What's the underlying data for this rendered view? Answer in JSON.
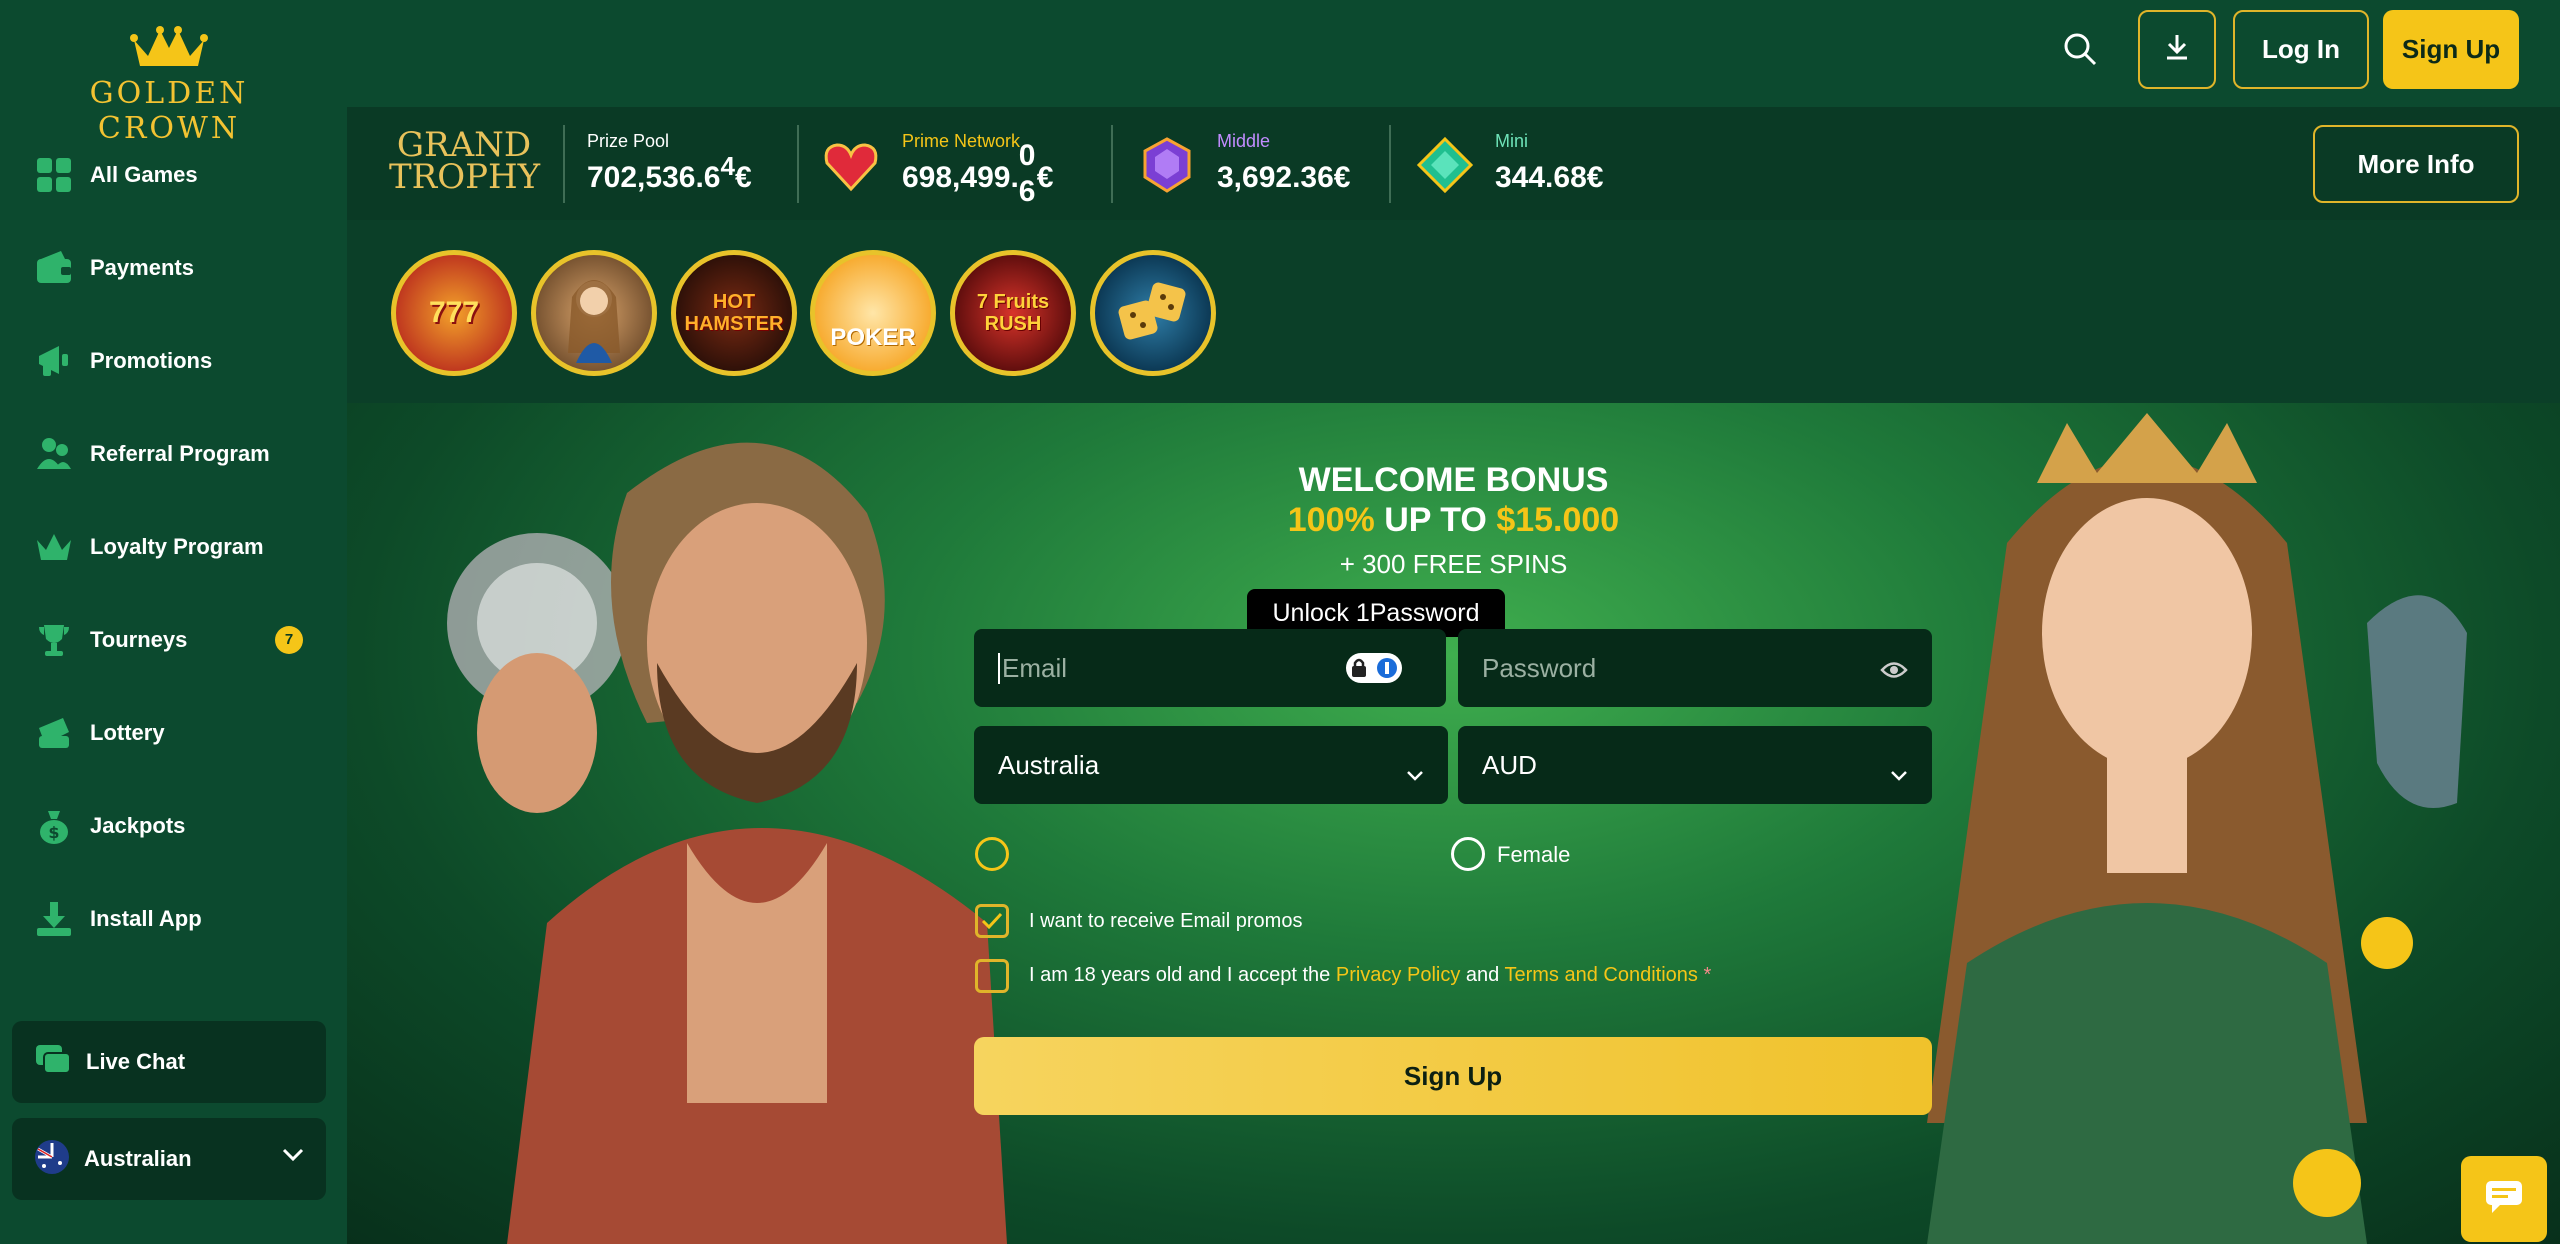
{
  "brand": {
    "name": "GOLDEN CROWN",
    "accent": "#f5c518"
  },
  "sidebar": {
    "items": [
      {
        "label": "All Games",
        "icon": "grid-icon"
      },
      {
        "label": "Payments",
        "icon": "wallet-icon"
      },
      {
        "label": "Promotions",
        "icon": "megaphone-icon"
      },
      {
        "label": "Referral Program",
        "icon": "users-icon"
      },
      {
        "label": "Loyalty Program",
        "icon": "crown-icon"
      },
      {
        "label": "Tourneys",
        "icon": "trophy-icon",
        "badge": "7"
      },
      {
        "label": "Lottery",
        "icon": "ticket-icon"
      },
      {
        "label": "Jackpots",
        "icon": "money-bag-icon"
      },
      {
        "label": "Install App",
        "icon": "download-icon"
      }
    ],
    "live_chat": "Live Chat",
    "language": "Australian"
  },
  "header": {
    "login": "Log In",
    "signup": "Sign Up"
  },
  "jackpot": {
    "logo_line1": "GRAND",
    "logo_line2": "TROPHY",
    "prize_pool_label": "Prize Pool",
    "prize_pool_value": "702,536.6",
    "prize_pool_digit": "4",
    "prime_label": "Prime Network",
    "prime_value": "698,499.",
    "prime_digit_top": "0",
    "prime_digit_bottom": "6",
    "middle_label": "Middle",
    "middle_value": "3,692.36€",
    "mini_label": "Mini",
    "mini_value": "344.68€",
    "currency": "€",
    "more_info": "More Info"
  },
  "games": [
    {
      "label": "777"
    },
    {
      "label": ""
    },
    {
      "label": "HOT HAMSTER"
    },
    {
      "label": "POKER"
    },
    {
      "label": "7 Fruits RUSH"
    },
    {
      "label": ""
    }
  ],
  "hero": {
    "title": "WELCOME BONUS",
    "bonus_percent": "100%",
    "bonus_upto": "UP TO",
    "bonus_amount": "$15.000",
    "free_spins": "+ 300 FREE SPINS",
    "tooltip": "Unlock 1Password",
    "email_placeholder": "Email",
    "password_placeholder": "Password",
    "country": "Australia",
    "currency": "AUD",
    "gender_female": "Female",
    "promo_label": "I want to receive Email promos",
    "terms_pre": "I am 18 years old and I accept the",
    "privacy_link": "Privacy Policy",
    "terms_and": "and",
    "terms_link": "Terms and Conditions",
    "required_mark": "*",
    "signup": "Sign Up"
  }
}
